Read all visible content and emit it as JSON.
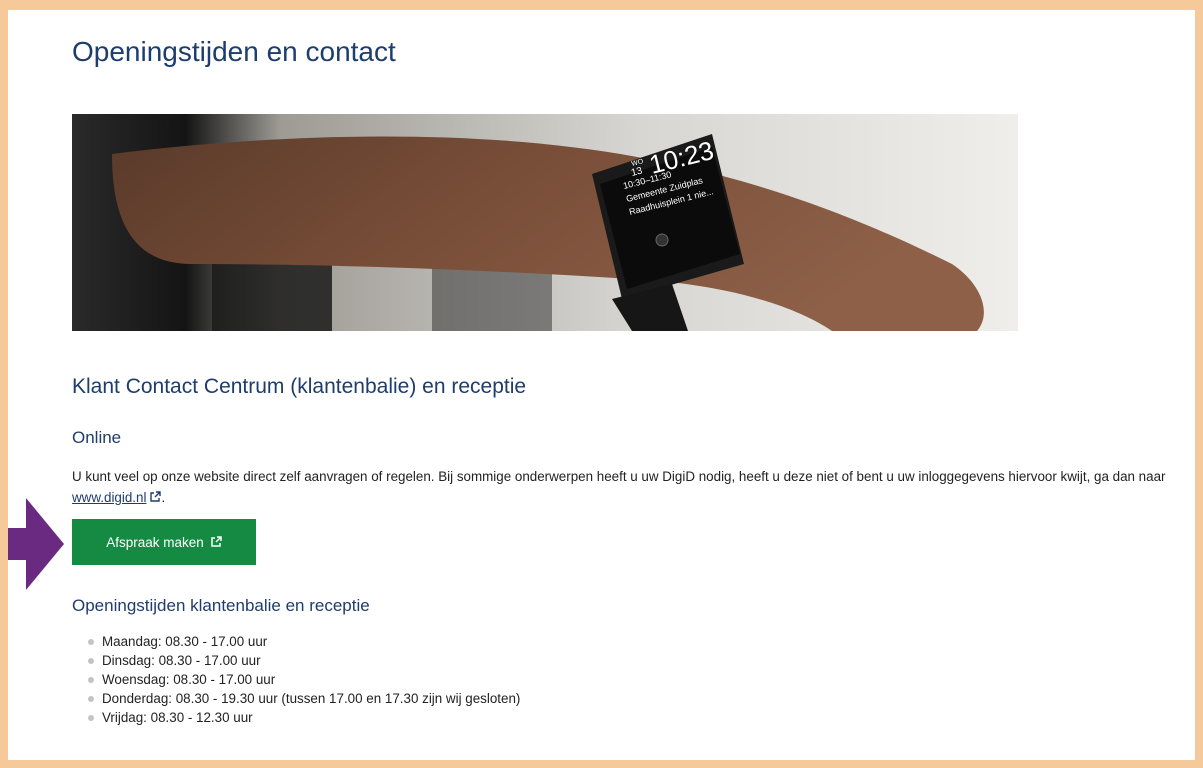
{
  "page_title": "Openingstijden en contact",
  "hero": {
    "watch_date_day": "13",
    "watch_date_label": "WO",
    "watch_time": "10:23",
    "watch_line1": "10:30–11:30",
    "watch_line2": "Gemeente Zuidplas",
    "watch_line3": "Raadhuisplein 1 nie..."
  },
  "section_title": "Klant Contact Centrum (klantenbalie) en receptie",
  "online": {
    "title": "Online",
    "text_before_link": "U kunt veel op onze website direct zelf aanvragen of regelen. Bij sommige onderwerpen heeft u uw DigiD nodig, heeft u deze niet of bent u uw inloggegevens hiervoor kwijt, ga dan naar ",
    "link_text": "www.digid.nl",
    "text_after_link": "."
  },
  "cta": {
    "label": "Afspraak maken"
  },
  "hours": {
    "title": "Openingstijden klantenbalie en receptie",
    "items": [
      "Maandag: 08.30 - 17.00 uur",
      "Dinsdag: 08.30 - 17.00 uur",
      "Woensdag: 08.30 - 17.00 uur",
      "Donderdag: 08.30 - 19.30 uur (tussen 17.00 en 17.30 zijn wij gesloten)",
      "Vrijdag: 08.30 - 12.30 uur"
    ]
  },
  "colors": {
    "frame": "#f5c99a",
    "heading": "#1d3d6e",
    "button": "#158a43",
    "arrow": "#6b2a82"
  }
}
